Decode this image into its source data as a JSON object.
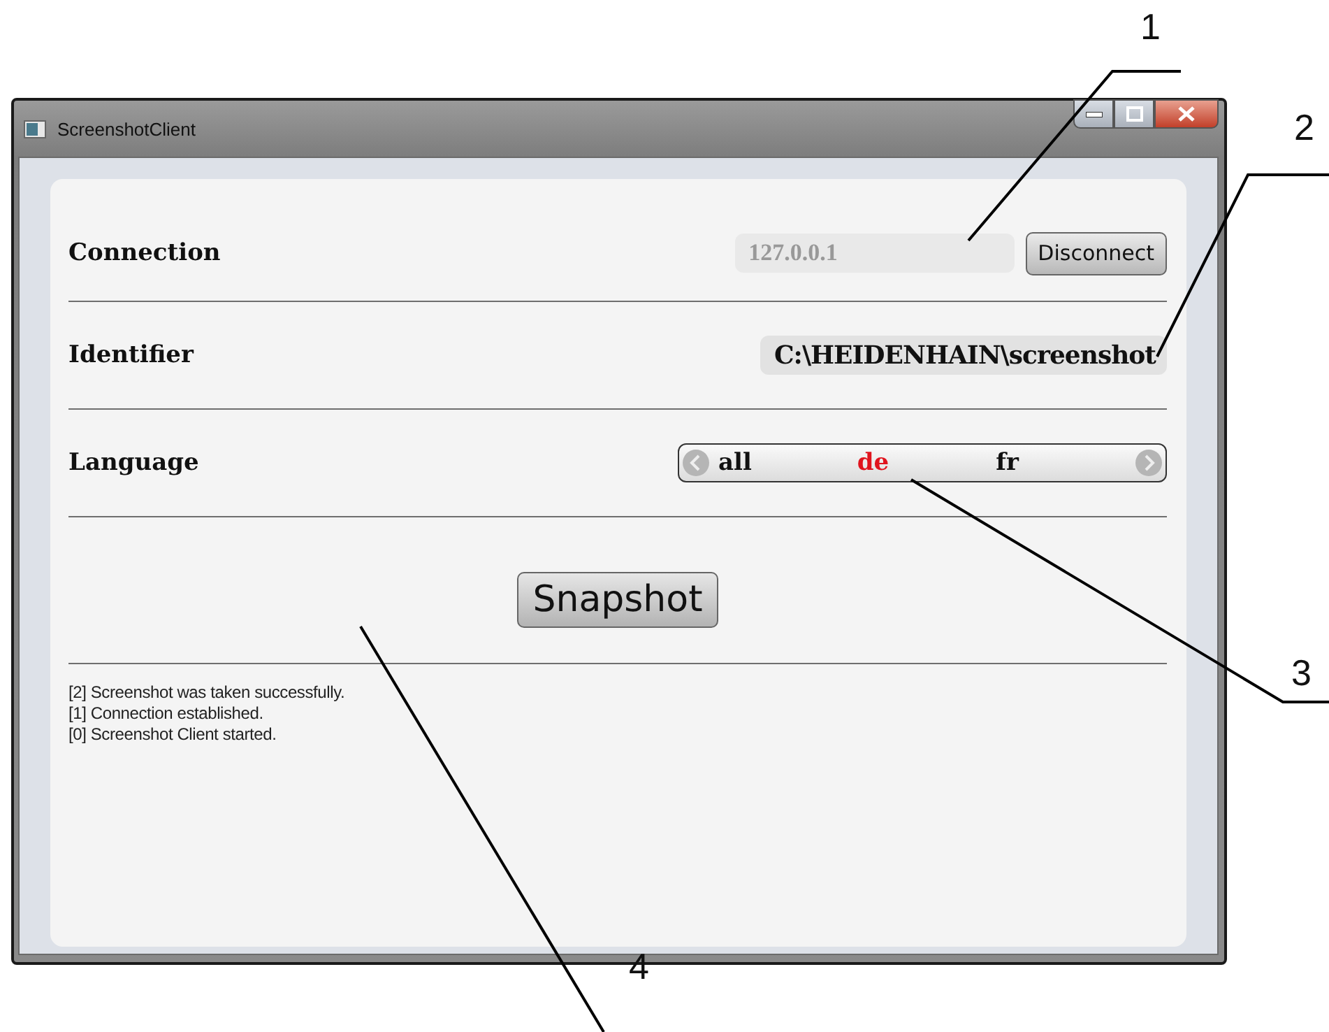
{
  "window": {
    "title": "ScreenshotClient"
  },
  "connection": {
    "label": "Connection",
    "address": "127.0.0.1",
    "button": "Disconnect"
  },
  "identifier": {
    "label": "Identifier",
    "value": "C:\\HEIDENHAIN\\screenshot"
  },
  "language": {
    "label": "Language",
    "options": [
      {
        "label": "all",
        "selected": false
      },
      {
        "label": "de",
        "selected": true
      },
      {
        "label": "fr",
        "selected": false
      }
    ]
  },
  "snapshot_button": "Snapshot",
  "log": [
    "[2] Screenshot was taken successfully.",
    "[1] Connection established.",
    "[0] Screenshot Client started."
  ],
  "callouts": [
    {
      "label": "1"
    },
    {
      "label": "2"
    },
    {
      "label": "3"
    },
    {
      "label": "4"
    }
  ]
}
